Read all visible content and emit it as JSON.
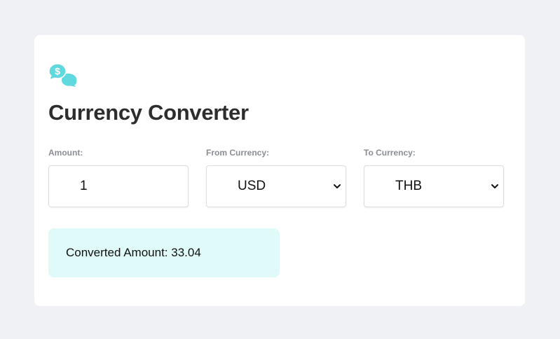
{
  "app": {
    "title": "Currency Converter",
    "logo_icon": "currency-chat-icon",
    "accent_color": "#5fd8e0"
  },
  "form": {
    "amount": {
      "label": "Amount:",
      "value": "1"
    },
    "from_currency": {
      "label": "From Currency:",
      "selected": "USD",
      "icon": "chevron-down-icon"
    },
    "to_currency": {
      "label": "To Currency:",
      "selected": "THB",
      "icon": "chevron-down-icon"
    }
  },
  "result": {
    "text": "Converted Amount: 33.04",
    "background": "#e0fafa"
  }
}
